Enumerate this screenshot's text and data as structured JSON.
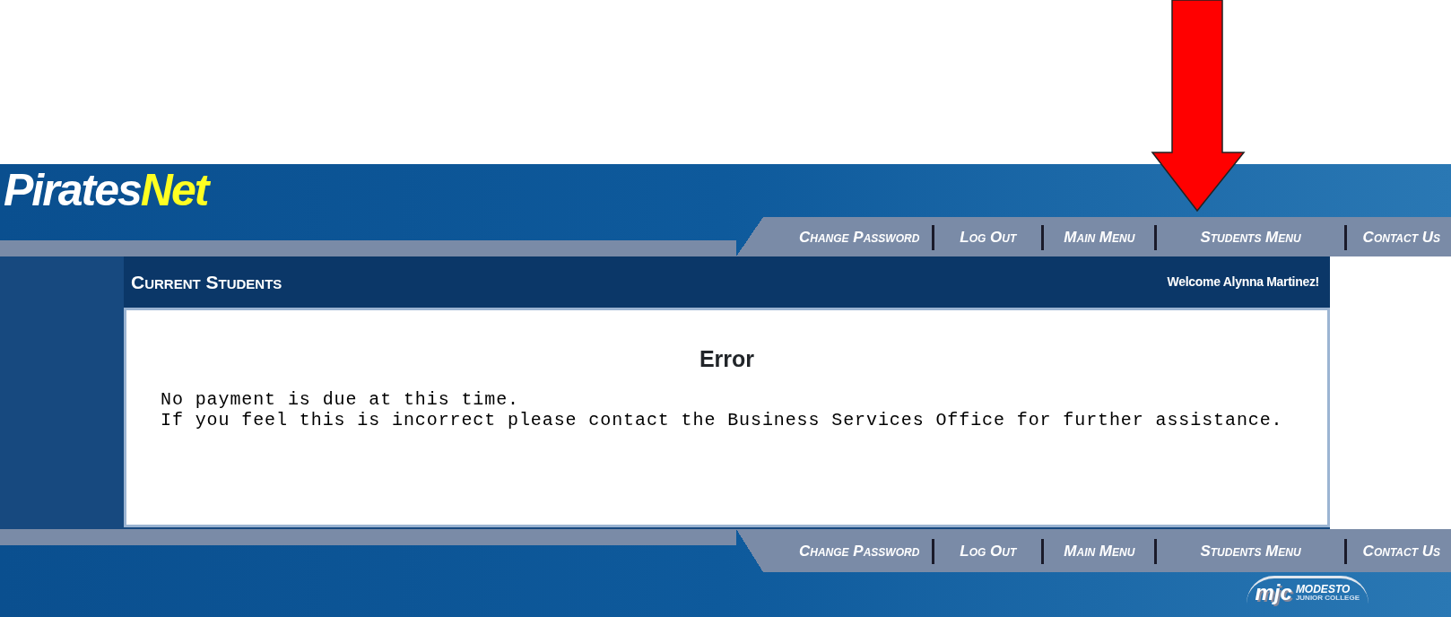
{
  "logo": {
    "primary": "Pirates",
    "accent": "Net"
  },
  "top_nav": [
    {
      "label": "Change Password"
    },
    {
      "label": "Log Out"
    },
    {
      "label": "Main Menu"
    },
    {
      "label": "Students Menu"
    },
    {
      "label": "Contact Us"
    }
  ],
  "section_title": "Current Students",
  "welcome": "Welcome Alynna Martinez!",
  "content": {
    "heading": "Error",
    "lines": [
      "No payment is due at this time.",
      "If you feel this is incorrect please contact the Business Services Office for further assistance."
    ]
  },
  "bottom_nav": [
    {
      "label": "Change Password"
    },
    {
      "label": "Log Out"
    },
    {
      "label": "Main Menu"
    },
    {
      "label": "Students Menu"
    },
    {
      "label": "Contact Us"
    }
  ],
  "footer_logo": {
    "mark": "mjc",
    "name": "MODESTO",
    "subtitle": "JUNIOR COLLEGE"
  }
}
